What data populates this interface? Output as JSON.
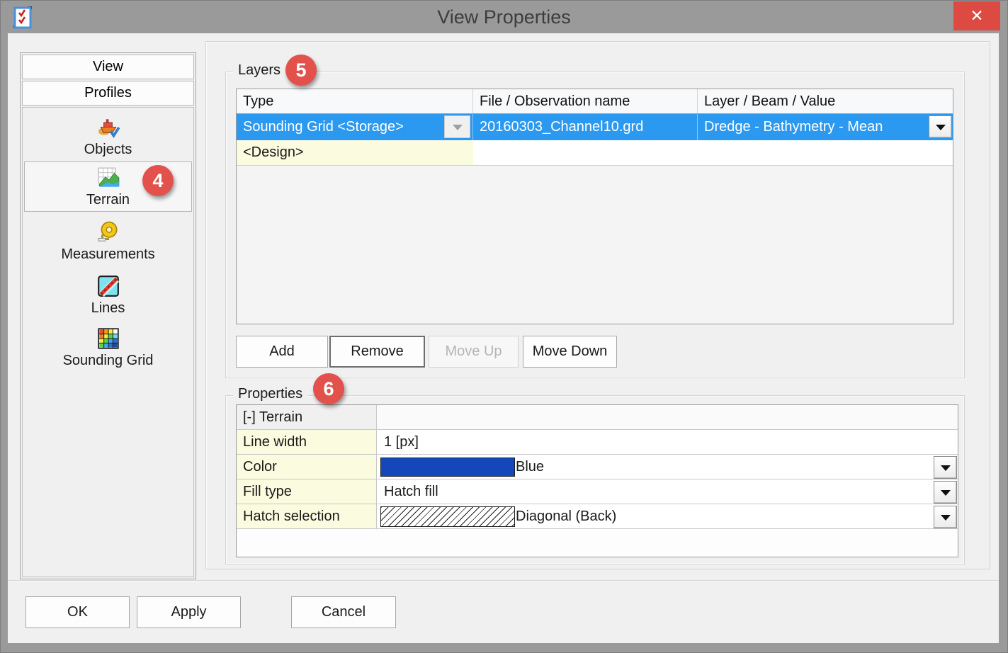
{
  "window": {
    "title": "View Properties",
    "close_glyph": "✕"
  },
  "sidebar": {
    "buttons": [
      {
        "label": "View"
      },
      {
        "label": "Profiles"
      }
    ],
    "items": [
      {
        "label": "Objects",
        "icon": "boat-icon",
        "selected": false
      },
      {
        "label": "Terrain",
        "icon": "terrain-icon",
        "selected": true,
        "badge": "4"
      },
      {
        "label": "Measurements",
        "icon": "tape-measure-icon",
        "selected": false
      },
      {
        "label": "Lines",
        "icon": "lines-icon",
        "selected": false
      },
      {
        "label": "Sounding Grid",
        "icon": "sounding-grid-icon",
        "selected": false
      }
    ]
  },
  "layers": {
    "group_label": "Layers",
    "badge": "5",
    "table": {
      "columns": [
        "Type",
        "File / Observation name",
        "Layer / Beam / Value"
      ],
      "rows": [
        {
          "type": "Sounding Grid <Storage>",
          "file": "20160303_Channel10.grd",
          "layer": "Dredge - Bathymetry - Mean",
          "selected": true,
          "type_dropdown": true,
          "layer_dropdown": true
        },
        {
          "type": "<Design>",
          "file": "",
          "layer": "",
          "selected": false
        }
      ]
    },
    "buttons": [
      {
        "label": "Add",
        "enabled": true
      },
      {
        "label": "Remove",
        "enabled": true,
        "focused": true
      },
      {
        "label": "Move Up",
        "enabled": false
      },
      {
        "label": "Move Down",
        "enabled": true
      }
    ]
  },
  "properties": {
    "group_label": "Properties",
    "badge": "6",
    "header": "[-] Terrain",
    "rows": [
      {
        "label": "Line width",
        "value": "1 [px]",
        "dropdown": false
      },
      {
        "label": "Color",
        "value": "Blue",
        "swatch": "color",
        "swatch_color": "#1347bb",
        "dropdown": true
      },
      {
        "label": "Fill type",
        "value": "Hatch fill",
        "dropdown": true
      },
      {
        "label": "Hatch selection",
        "value": "Diagonal (Back)",
        "swatch": "hatch",
        "dropdown": true
      }
    ]
  },
  "footer": {
    "buttons": [
      {
        "label": "OK"
      },
      {
        "label": "Apply"
      },
      {
        "label": "Cancel"
      }
    ]
  },
  "colors": {
    "titlebar": "#9a9a9a",
    "close_button": "#dc4a41",
    "selection_blue": "#2b99f0",
    "row_yellow": "#fbfbdf",
    "badge_red": "#e2514b",
    "swatch_blue": "#1347bb"
  }
}
